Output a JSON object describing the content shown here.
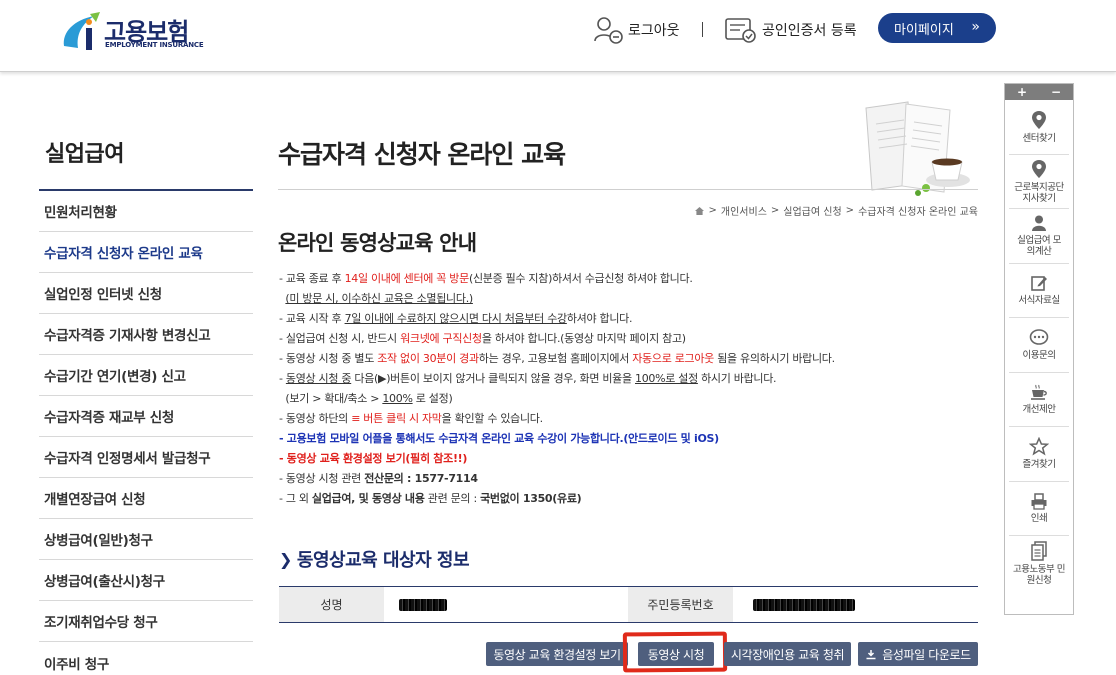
{
  "header": {
    "logo_kr": "고용보험",
    "logo_en": "EMPLOYMENT INSURANCE",
    "logout": "로그아웃",
    "cert": "공인인증서 등록",
    "mypage": "마이페이지",
    "mypage_chevron": "»"
  },
  "lnb": {
    "title": "실업급여",
    "items": [
      {
        "label": "민원처리현황"
      },
      {
        "label": "수급자격 신청자 온라인 교육"
      },
      {
        "label": "실업인정 인터넷 신청"
      },
      {
        "label": "수급자격증 기재사항 변경신고"
      },
      {
        "label": "수급기간 연기(변경) 신고"
      },
      {
        "label": "수급자격증 재교부 신청"
      },
      {
        "label": "수급자격 인정명세서 발급청구"
      },
      {
        "label": "개별연장급여 신청"
      },
      {
        "label": "상병급여(일반)청구"
      },
      {
        "label": "상병급여(출산시)청구"
      },
      {
        "label": "조기재취업수당 청구"
      },
      {
        "label": "이주비 청구"
      }
    ]
  },
  "main": {
    "page_title": "수급자격 신청자 온라인 교육",
    "breadcrumb": [
      "개인서비스",
      "실업급여 신청",
      "수급자격 신청자 온라인 교육"
    ],
    "breadcrumb_sep": ">",
    "sub_title": "온라인 동영상교육 안내",
    "notice": {
      "l1a": "- 교육 종료 후 ",
      "l1b": "14일 이내에 센터에 꼭 방문",
      "l1c": "(신분증 필수 지참)하셔서 수급신청 하셔야 합니다.",
      "l2": "(미 방문 시, 이수하신 교육은 소멸됩니다.)",
      "l3a": "- 교육 시작 후 ",
      "l3b": "7일 이내에 수료하지 않으시면 다시 처음부터 수강",
      "l3c": "하셔야 합니다.",
      "l4a": "- 실업급여 신청 시, 반드시 ",
      "l4b": "워크넷에 구직신청",
      "l4c": "을 하셔야 합니다.(동영상 마지막 페이지 참고)",
      "l5a": "- 동영상 시청 중 별도 ",
      "l5b": "조작 없이 30분이 경과",
      "l5c": "하는 경우, 고용보험 홈페이지에서 ",
      "l5d": "자동으로 로그아웃",
      "l5e": " 됨을 유의하시기 바랍니다.",
      "l6a": "- ",
      "l6b": "동영상 시청 중",
      "l6c": " 다음(▶)버튼이 보이지 않거나 클릭되지 않을 경우, 화면 비율을 ",
      "l6d": "100%로 설정",
      "l6e": " 하시기 바랍니다.",
      "l7a": "(보기 > 확대/축소 > ",
      "l7b": "100%",
      "l7c": " 로 설정)",
      "l8a": "- 동영상 하단의 ",
      "l8b": "≡ 버튼 클릭 시 자막",
      "l8c": "을 확인할 수 있습니다.",
      "l9": "- 고용보험 모바일 어플을 통해서도 수급자격 온라인 교육 수강이 가능합니다.(안드로이드 및 iOS)",
      "l10": "- 동영상 교육 환경설정 보기(필히 참조!!)",
      "l11a": "- 동영상 시청 관련 ",
      "l11b": "전산문의 : 1577-7114",
      "l12a": "- 그 외 ",
      "l12b": "실업급여, 및 동영상 내용",
      "l12c": " 관련 문의 : ",
      "l12d": "국번없이 1350(유료)"
    },
    "section_title": "동영상교육 대상자 정보",
    "table": {
      "name_label": "성명",
      "rrn_label": "주민등록번호"
    },
    "buttons": {
      "env": "동영상 교육 환경설정 보기",
      "play": "동영상 시청",
      "vi": "시각장애인용 교육 청취",
      "dl": "음성파일 다운로드"
    }
  },
  "quick": {
    "plus": "+",
    "minus": "−",
    "items": [
      {
        "label": "센터찾기",
        "icon": "map-pin-icon"
      },
      {
        "label": "근로복지공단 지사찾기",
        "icon": "map-pin-icon"
      },
      {
        "label": "실업급여 모의계산",
        "icon": "person-icon"
      },
      {
        "label": "서식자료실",
        "icon": "edit-icon"
      },
      {
        "label": "이용문의",
        "icon": "chat-icon"
      },
      {
        "label": "개선제안",
        "icon": "cup-icon"
      },
      {
        "label": "즐겨찾기",
        "icon": "star-icon"
      },
      {
        "label": "인쇄",
        "icon": "print-icon"
      },
      {
        "label": "고용노동부 민원신청",
        "icon": "document-icon"
      }
    ]
  },
  "colors": {
    "brand": "#1b2c6b",
    "accent_red": "#e0201c",
    "accent_blue": "#1c33b5",
    "button": "#4f5f7e",
    "mypage": "#1b3f8b"
  }
}
